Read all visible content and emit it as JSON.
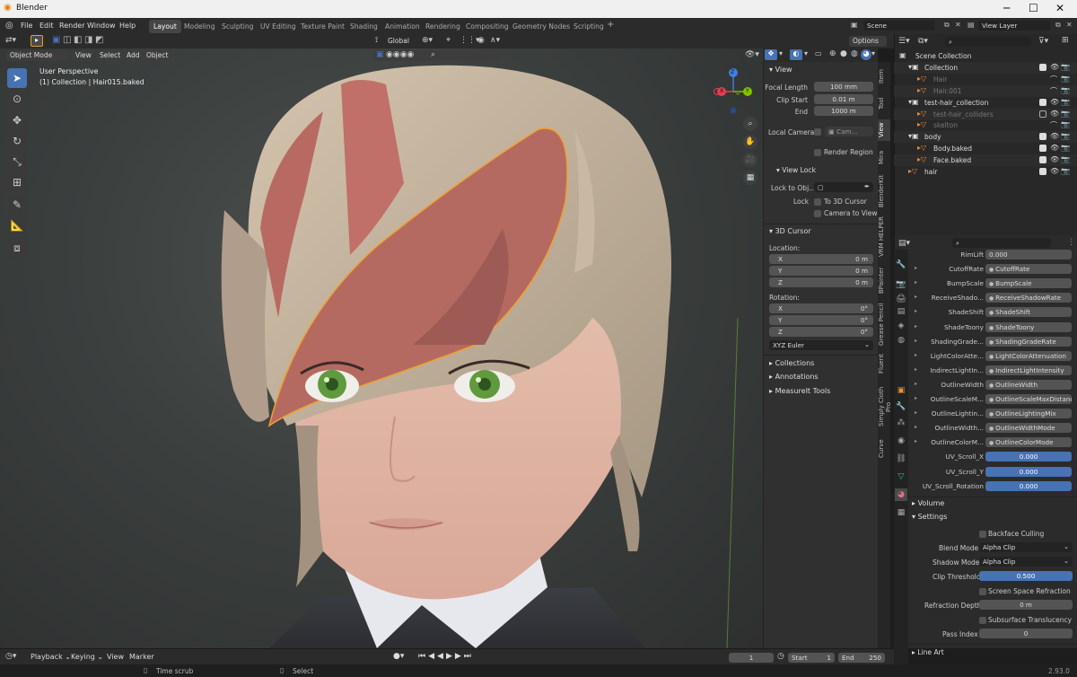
{
  "window": {
    "title": "Blender",
    "minimize": "─",
    "maximize": "☐",
    "close": "✕"
  },
  "menu": [
    "File",
    "Edit",
    "Render",
    "Window",
    "Help"
  ],
  "workspaces": [
    "Layout",
    "Modeling",
    "Sculpting",
    "UV Editing",
    "Texture Paint",
    "Shading",
    "Animation",
    "Rendering",
    "Compositing",
    "Geometry Nodes",
    "Scripting"
  ],
  "active_workspace": "Layout",
  "scene": {
    "name": "Scene",
    "view_layer": "View Layer"
  },
  "viewport_header": {
    "mode": "Object Mode",
    "view": "View",
    "select": "Select",
    "add": "Add",
    "object": "Object",
    "orientation": "Global",
    "options": "Options"
  },
  "viewport": {
    "perspective": "User Perspective",
    "collection": "(1) Collection | Hair015.baked"
  },
  "gizmo": {
    "x": "X",
    "y": "Y",
    "z": "Z"
  },
  "npanel": {
    "view_title": "View",
    "focal_length_label": "Focal Length",
    "focal_length": "100 mm",
    "clip_start_label": "Clip Start",
    "clip_start": "0.01 m",
    "end_label": "End",
    "clip_end": "1000 m",
    "local_camera_label": "Local Camera",
    "local_camera_value": "Cam...",
    "render_region": "Render Region",
    "view_lock_title": "View Lock",
    "lock_to_obj_label": "Lock to Obj...",
    "lock_label": "Lock",
    "to_3d_cursor": "To 3D Cursor",
    "camera_to_view": "Camera to View",
    "cursor_title": "3D Cursor",
    "location_label": "Location:",
    "loc": [
      {
        "axis": "X",
        "value": "0 m"
      },
      {
        "axis": "Y",
        "value": "0 m"
      },
      {
        "axis": "Z",
        "value": "0 m"
      }
    ],
    "rotation_label": "Rotation:",
    "rot": [
      {
        "axis": "X",
        "value": "0°"
      },
      {
        "axis": "Y",
        "value": "0°"
      },
      {
        "axis": "Z",
        "value": "0°"
      }
    ],
    "rotation_mode": "XYZ Euler",
    "collapsed": [
      "Collections",
      "Annotations",
      "MeasureIt Tools"
    ]
  },
  "ntabs": [
    "Item",
    "Tool",
    "View",
    "Mira",
    "BlenderKit",
    "VRM HELPER",
    "BPainter",
    "Grease Pencil",
    "Fluent",
    "Simply Cloth Pro",
    "Curve"
  ],
  "outliner": {
    "rows": [
      {
        "name": "Scene Collection",
        "indent": 0,
        "dim": false
      },
      {
        "name": "Collection",
        "indent": 1,
        "dim": false
      },
      {
        "name": "Hair",
        "indent": 2,
        "dim": true
      },
      {
        "name": "Hair.001",
        "indent": 2,
        "dim": true
      },
      {
        "name": "test-hair_collection",
        "indent": 1,
        "dim": false
      },
      {
        "name": "test-hair_colliders",
        "indent": 2,
        "dim": true
      },
      {
        "name": "skelton",
        "indent": 2,
        "dim": true
      },
      {
        "name": "body",
        "indent": 1,
        "dim": false
      },
      {
        "name": "Body.baked",
        "indent": 2,
        "dim": false
      },
      {
        "name": "Face.baked",
        "indent": 2,
        "dim": false
      },
      {
        "name": "hair",
        "indent": 1,
        "dim": false
      }
    ]
  },
  "props": {
    "rows": [
      {
        "label": "RimLift",
        "value": "0.000",
        "blue": false,
        "tri": false
      },
      {
        "label": "CutoffRate",
        "value": "CutoffRate",
        "blue": false,
        "tri": true
      },
      {
        "label": "BumpScale",
        "value": "BumpScale",
        "blue": false,
        "tri": true
      },
      {
        "label": "ReceiveShado...",
        "value": "ReceiveShadowRate",
        "blue": false,
        "tri": true
      },
      {
        "label": "ShadeShift",
        "value": "ShadeShift",
        "blue": false,
        "tri": true
      },
      {
        "label": "ShadeToony",
        "value": "ShadeToony",
        "blue": false,
        "tri": true
      },
      {
        "label": "ShadingGrade...",
        "value": "ShadingGradeRate",
        "blue": false,
        "tri": true
      },
      {
        "label": "LightColorAtte...",
        "value": "LightColorAttenuation",
        "blue": false,
        "tri": true
      },
      {
        "label": "IndirectLightIn...",
        "value": "IndirectLightIntensity",
        "blue": false,
        "tri": true
      },
      {
        "label": "OutlineWidth",
        "value": "OutlineWidth",
        "blue": false,
        "tri": true
      },
      {
        "label": "OutlineScaleM...",
        "value": "OutlineScaleMaxDistanc",
        "blue": false,
        "tri": true
      },
      {
        "label": "OutlineLightin...",
        "value": "OutlineLightingMix",
        "blue": false,
        "tri": true
      },
      {
        "label": "OutlineWidth...",
        "value": "OutlineWidthMode",
        "blue": false,
        "tri": true
      },
      {
        "label": "OutlineColorM...",
        "value": "OutlineColorMode",
        "blue": false,
        "tri": true
      },
      {
        "label": "UV_Scroll_X",
        "value": "0.000",
        "blue": true,
        "tri": false
      },
      {
        "label": "UV_Scroll_Y",
        "value": "0.000",
        "blue": true,
        "tri": false
      },
      {
        "label": "UV_Scroll_Rotation",
        "value": "0.000",
        "blue": true,
        "tri": false
      }
    ],
    "volume": "Volume",
    "settings": "Settings",
    "backface_culling": "Backface Culling",
    "blend_mode_label": "Blend Mode",
    "blend_mode": "Alpha Clip",
    "shadow_mode_label": "Shadow Mode",
    "shadow_mode": "Alpha Clip",
    "clip_threshold_label": "Clip Threshold",
    "clip_threshold": "0.500",
    "ssr": "Screen Space Refraction",
    "refraction_depth_label": "Refraction Depth",
    "refraction_depth": "0 m",
    "subsurface": "Subsurface Translucency",
    "pass_index_label": "Pass Index",
    "pass_index": "0",
    "line_art": "Line Art"
  },
  "timeline": {
    "playback": "Playback",
    "keying": "Keying",
    "view": "View",
    "marker": "Marker",
    "frame": "1",
    "start_label": "Start",
    "start": "1",
    "end_label": "End",
    "end": "250"
  },
  "status": {
    "time_scrub": "Time scrub",
    "select": "Select",
    "version": "2.93.0"
  },
  "colors": {
    "accent": "#4772b3",
    "hair_outline": "#f0a030"
  }
}
